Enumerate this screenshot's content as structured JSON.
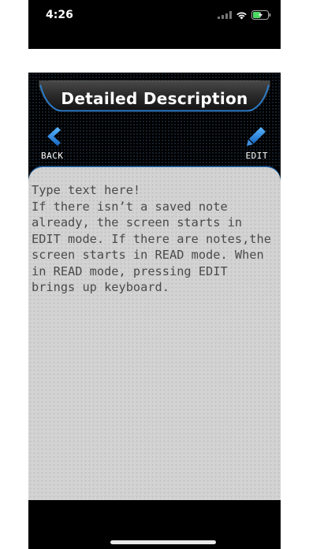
{
  "status_bar": {
    "time": "4:26",
    "icons": [
      "signal-icon",
      "wifi-icon",
      "battery-charging-icon"
    ]
  },
  "header": {
    "title": "Detailed Description",
    "back_label": "BACK",
    "edit_label": "EDIT"
  },
  "note": {
    "text": "Type text here!\nIf there isn’t a saved note already, the screen starts in EDIT mode. If there are notes,the screen starts in READ mode. When in READ mode, pressing EDIT brings up keyboard."
  },
  "colors": {
    "accent_blue": "#1e88e5",
    "panel_gray": "#d3d3d3",
    "background": "#000000"
  }
}
